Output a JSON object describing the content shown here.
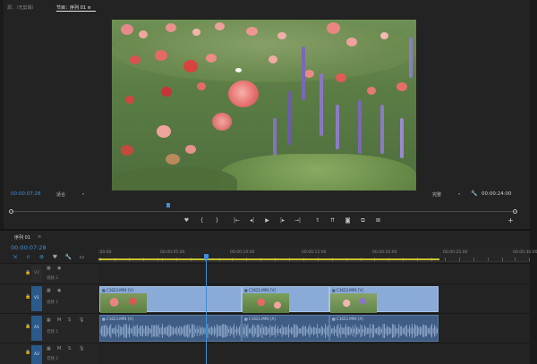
{
  "monitor": {
    "tab_source": "源：（无剪辑）",
    "tab_program": "节目：序列 01",
    "tab_program_menu": "≡",
    "timecode_current": "00:00:07:28",
    "fit_label": "适合",
    "quality_label": "完整",
    "timecode_duration": "00:00:24:00",
    "transport": [
      {
        "name": "marker-icon",
        "glyph": "♥"
      },
      {
        "name": "mark-in-icon",
        "glyph": "{"
      },
      {
        "name": "mark-out-icon",
        "glyph": "}"
      },
      {
        "name": "go-to-in-icon",
        "glyph": "|←"
      },
      {
        "name": "step-back-icon",
        "glyph": "◂|"
      },
      {
        "name": "play-icon",
        "glyph": "▶"
      },
      {
        "name": "step-forward-icon",
        "glyph": "|▸"
      },
      {
        "name": "go-to-out-icon",
        "glyph": "→|"
      },
      {
        "name": "lift-icon",
        "glyph": "⇑"
      },
      {
        "name": "extract-icon",
        "glyph": "⇈"
      },
      {
        "name": "export-frame-icon",
        "glyph": "◙"
      },
      {
        "name": "compare-icon",
        "glyph": "⧉"
      },
      {
        "name": "settings-icon",
        "glyph": "⊠"
      }
    ],
    "add_button": "+"
  },
  "timeline": {
    "tab_label": "序列 01",
    "tab_menu": "≡",
    "timecode": "00:00:07:28",
    "ruler_labels": [
      ":00:00",
      "00:00:05:00",
      "00:00:10:00",
      "00:00:15:00",
      "00:00:20:00",
      "00:00:25:00",
      "00:00:30:00"
    ],
    "tracks": {
      "v2": {
        "label": "V2",
        "name": "视频 2"
      },
      "v1": {
        "label": "V1",
        "name": "视频 1",
        "target": "V1"
      },
      "a1": {
        "label": "A1",
        "name": "音频 1",
        "target": "A1",
        "m": "M",
        "s": "S"
      },
      "a2": {
        "label": "A2",
        "name": "音频 2",
        "target": "A2",
        "m": "M",
        "s": "S"
      }
    },
    "video_clips": [
      {
        "label": "C1623.MP4 [V]"
      },
      {
        "label": "C1621.MP4 [V]"
      },
      {
        "label": "C1622.MP4 [V]"
      }
    ],
    "audio_clips": [
      {
        "label": "C1623.MP4 [A]"
      },
      {
        "label": "C1621.MP4 [A]"
      },
      {
        "label": "C1622.MP4 [A]"
      }
    ],
    "colors": {
      "accent": "#3e8fd8",
      "video_clip": "#8aaad8",
      "audio_clip": "#3f5d85",
      "work_area": "#c9c431"
    }
  }
}
